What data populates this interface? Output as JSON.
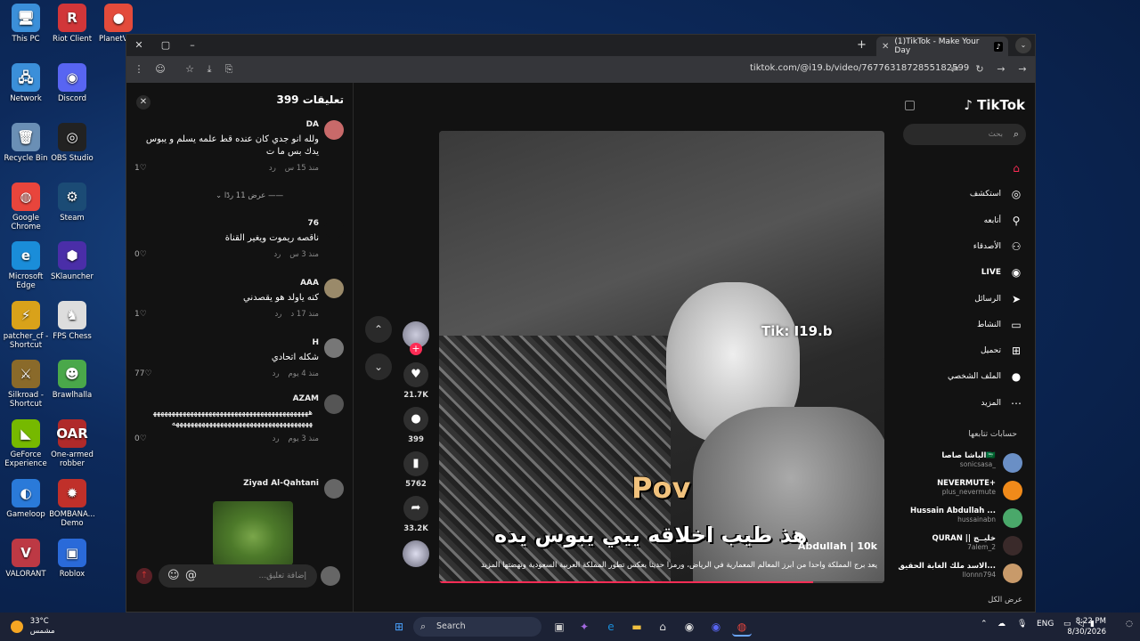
{
  "desktop": {
    "icons": [
      {
        "label": "This PC",
        "glyph": "🖥",
        "color": "#3b8fd9"
      },
      {
        "label": "Riot Client",
        "glyph": "R",
        "color": "#d13639"
      },
      {
        "label": "PlanetVPN",
        "glyph": "●",
        "color": "#e34b3b"
      },
      {
        "label": "Network",
        "glyph": "🖧",
        "color": "#3b8fd9"
      },
      {
        "label": "Discord",
        "glyph": "◉",
        "color": "#5865f2"
      },
      {
        "label": "Recycle Bin",
        "glyph": "🗑",
        "color": "#6a8fb5"
      },
      {
        "label": "OBS Studio",
        "glyph": "◎",
        "color": "#222"
      },
      {
        "label": "Google Chrome",
        "glyph": "◍",
        "color": "#e8453c"
      },
      {
        "label": "Steam",
        "glyph": "⚙",
        "color": "#1b4b75"
      },
      {
        "label": "Microsoft Edge",
        "glyph": "e",
        "color": "#1a8dd9"
      },
      {
        "label": "SKlauncher",
        "glyph": "⬢",
        "color": "#4a2ea8"
      },
      {
        "label": "patcher_cf - Shortcut",
        "glyph": "⚡",
        "color": "#d9a21a"
      },
      {
        "label": "FPS Chess",
        "glyph": "♞",
        "color": "#ddd"
      },
      {
        "label": "Silkroad - Shortcut",
        "glyph": "⚔",
        "color": "#8a6a2a"
      },
      {
        "label": "Brawlhalla",
        "glyph": "☻",
        "color": "#4aa84a"
      },
      {
        "label": "GeForce Experience",
        "glyph": "◣",
        "color": "#76b900"
      },
      {
        "label": "One-armed robber",
        "glyph": "OAR",
        "color": "#b02a2a"
      },
      {
        "label": "Gameloop",
        "glyph": "◐",
        "color": "#2a7ad9"
      },
      {
        "label": "BOMBANA... Demo",
        "glyph": "✹",
        "color": "#c0302a"
      },
      {
        "label": "VALORANT",
        "glyph": "V",
        "color": "#bd3944"
      },
      {
        "label": "Roblox",
        "glyph": "▣",
        "color": "#2a6ad9"
      }
    ]
  },
  "browser": {
    "tab_title": "(1)TikTok - Make Your Day",
    "url": "tiktok.com/@i19.b/video/7677631872855182599"
  },
  "comments": {
    "header": "تعليقات 399",
    "items": [
      {
        "user": "DA",
        "text": "ولله انو جدي كان عنده قط علمه يسلم و يبوس يدك بس ما ت",
        "time": "منذ 15 س",
        "reply": "رد",
        "likes": "1",
        "avatar_color": "#c86a6a"
      },
      {
        "user": "76",
        "text": "ناقصه ريموت ويغير القناة",
        "time": "منذ 3 س",
        "reply": "رد",
        "likes": "0",
        "avatar_color": "#121212"
      },
      {
        "user": "AAA",
        "text": "كنه ياولد هو يقصدني",
        "time": "منذ 17 د",
        "reply": "رد",
        "likes": "1",
        "avatar_color": "#9a8a6a"
      },
      {
        "user": "H",
        "text": "شكله اتحادي",
        "time": "منذ 4 يوم",
        "reply": "رد",
        "likes": "77",
        "avatar_color": "#777"
      },
      {
        "user": "AZAM",
        "text": "ههههههههههههههههههههههههههههههههههههههههههههههههههههههههههههههههههههههههههههههههه",
        "time": "منذ 3 يوم",
        "reply": "رد",
        "likes": "0",
        "avatar_color": "#555"
      },
      {
        "user": "Ziyad Al-Qahtani",
        "avatar_color": "#666"
      }
    ],
    "replies_toggle": "عرض 11 ردًا",
    "input_placeholder": "إضافة تعليق..."
  },
  "video": {
    "watermark": "Tik: I19.b",
    "pov_text": "Pov",
    "subtitle": "هذ طيب اخلاقه ييي يبوس يده",
    "creator": "Abdullah | 10k",
    "description": "يعد برج المملكة واحدا من أبرز المعالم المعمارية في الرياض، ورمزا حديثا يعكس تطور المملكة العربية السعودية ونهضتها المزيد",
    "progress": 0.84,
    "actions": [
      {
        "name": "like",
        "glyph": "♥",
        "count": "21.7K"
      },
      {
        "name": "comment",
        "glyph": "●",
        "count": "399"
      },
      {
        "name": "bookmark",
        "glyph": "▮",
        "count": "5762"
      },
      {
        "name": "share",
        "glyph": "➦",
        "count": "33.2K"
      }
    ]
  },
  "sidebar": {
    "logo": "TikTok",
    "search_placeholder": "بحث",
    "nav": [
      {
        "label": "",
        "icon": "⌂",
        "active": true
      },
      {
        "label": "استكشف",
        "icon": "◎",
        "active": false
      },
      {
        "label": "أتابعه",
        "icon": "⚲",
        "active": false
      },
      {
        "label": "الأصدقاء",
        "icon": "⚇",
        "active": false
      },
      {
        "label": "LIVE",
        "icon": "◉",
        "active": false
      },
      {
        "label": "الرسائل",
        "icon": "➤",
        "active": false
      },
      {
        "label": "النشاط",
        "icon": "▭",
        "active": false
      },
      {
        "label": "تحميل",
        "icon": "⊞",
        "active": false
      },
      {
        "label": "الملف الشخصي",
        "icon": "●",
        "active": false
      },
      {
        "label": "المزيد",
        "icon": "⋯",
        "active": false
      }
    ],
    "following_header": "حسابات تتابعها",
    "accounts": [
      {
        "name": "الباشا صاصا🇸🇦",
        "handle": "sonicsasa_",
        "color": "#6a8fc5"
      },
      {
        "name": "NEVERMUTE+",
        "handle": "plus_nevermute",
        "color": "#f08a1a"
      },
      {
        "name": "Hussain Abdullah ...",
        "handle": "hussainabn",
        "color": "#4aa86a"
      },
      {
        "name": "QURAN || خليــج",
        "handle": "7alem_2",
        "color": "#3a2a2a"
      },
      {
        "name": "الاسد ملك الغابة الحقيق...",
        "handle": "llonnn794",
        "color": "#c89a6a"
      }
    ],
    "see_all": "عرض الكل"
  },
  "taskbar": {
    "temperature": "33°C",
    "weather_text": "مشمس",
    "search_label": "Search",
    "language": "ENG",
    "time": "8:22 PM",
    "date": "8/30/2026"
  }
}
